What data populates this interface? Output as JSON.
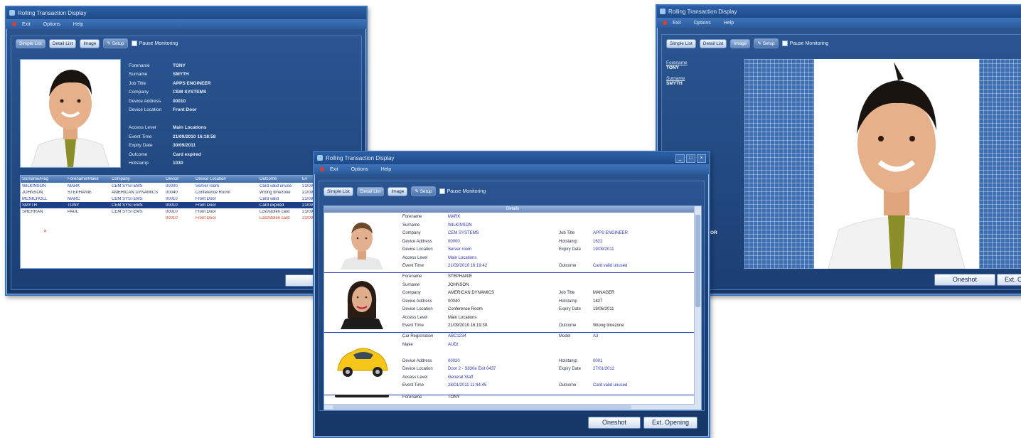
{
  "windows": {
    "title": "Rolling Transaction Display",
    "menu": [
      "Exit",
      "Options",
      "Help"
    ],
    "buttons": {
      "simple_list": "Simple List",
      "detail_list": "Detail List",
      "image": "Image",
      "setup": "Setup",
      "pause": "Pause Monitoring",
      "oneshot": "Oneshot",
      "ext_opening": "Ext. Opening",
      "oneshot_cut": "Onesh",
      "ext_cut": "Ext. Op"
    }
  },
  "left": {
    "fields": [
      {
        "k": "Forename",
        "v": "TONY"
      },
      {
        "k": "Surname",
        "v": "SMYTH"
      },
      {
        "k": "Job Title",
        "v": "APPS ENGINEER"
      },
      {
        "k": "Company",
        "v": "CEM SYSTEMS"
      },
      {
        "k": "Device Address",
        "v": "00010"
      },
      {
        "k": "Device Location",
        "v": "Front Door"
      },
      {
        "k": "",
        "v": ""
      },
      {
        "k": "Access Level",
        "v": "Main Locations"
      },
      {
        "k": "Event Time",
        "v": "21/09/2010 16:18:58"
      },
      {
        "k": "Expiry Date",
        "v": "30/09/2011"
      },
      {
        "k": "Outcome",
        "v": "Card expired"
      },
      {
        "k": "Hotstamp",
        "v": "1030"
      }
    ],
    "table": {
      "headers": [
        "Surname/Reg",
        "Forename/Make",
        "Company",
        "Device",
        "Device Location",
        "Outcome",
        "Ev"
      ],
      "rows": [
        [
          "WILKINSON",
          "MARK",
          "CEM SYSTEMS",
          "00000",
          "Server room",
          "Card valid unuse",
          "21/09/"
        ],
        [
          "JOHNSON",
          "STEPHANIE",
          "AMERICAN DYNAMICS",
          "00040",
          "Conference Room",
          "Wrong timezone",
          "21/09/"
        ],
        [
          "MCNICHOLL",
          "MARC",
          "CEM SYSTEMS",
          "00010",
          "Front Door",
          "Card valid",
          "21/09/"
        ],
        [
          "SMYTH",
          "TONY",
          "CEM SYSTEMS",
          "00010",
          "Front Door",
          "Card expired",
          "21/09/"
        ],
        [
          "SHERRAN",
          "PAUL",
          "CEM SYSTEMS",
          "00010",
          "Front Door",
          "Lost/stolen card",
          "21/09/"
        ],
        [
          "",
          "",
          "",
          "00010",
          "Front Door",
          "Lost/stolen card",
          "21/09/"
        ]
      ]
    }
  },
  "right": {
    "forename_label": "Forename",
    "forename": "TONY",
    "surname_label": "Surname",
    "surname": "SMYTH",
    "stray": "OR"
  },
  "middle": {
    "details_header": "Details",
    "cards": [
      {
        "left": [
          [
            "Forename",
            "MARK"
          ],
          [
            "Surname",
            "WILKINSON"
          ],
          [
            "Company",
            "CEM SYSTEMS"
          ],
          [
            "Device Address",
            "00000"
          ],
          [
            "Device Location",
            "Server room"
          ],
          [
            "Access Level",
            "Main Locations"
          ],
          [
            "Event Time",
            "21/09/2010 16:19:42"
          ]
        ],
        "right": [
          [
            "Job Title",
            "APPS ENGINEER"
          ],
          [
            "Hotstamp",
            "1622"
          ],
          [
            "Expiry Date",
            "19/09/2011"
          ],
          [
            "",
            ""
          ],
          [
            "Outcome",
            "Card valid unused"
          ]
        ]
      },
      {
        "left": [
          [
            "Forename",
            "STEPHANIE"
          ],
          [
            "Surname",
            "JOHNSON"
          ],
          [
            "Company",
            "AMERICAN DYNAMICS"
          ],
          [
            "Device Address",
            "00040"
          ],
          [
            "Device Location",
            "Conference Room"
          ],
          [
            "Access Level",
            "Main Locations"
          ],
          [
            "Event Time",
            "21/09/2010 16:19:30"
          ]
        ],
        "right": [
          [
            "Job Title",
            "MANAGER"
          ],
          [
            "Hotstamp",
            "1827"
          ],
          [
            "Expiry Date",
            "19/06/2011"
          ],
          [
            "",
            ""
          ],
          [
            "Outcome",
            "Wrong timezone"
          ]
        ]
      },
      {
        "left": [
          [
            "Car Registration",
            "ABC1234"
          ],
          [
            "Make",
            "AUDI"
          ],
          [
            "",
            ""
          ],
          [
            "Device Address",
            "00020"
          ],
          [
            "Device Location",
            "Door 2 - S830e Exit 0437"
          ],
          [
            "Access Level",
            "General Staff"
          ],
          [
            "Event Time",
            "28/01/2011 11:44:45"
          ]
        ],
        "right": [
          [
            "Model",
            "A3"
          ],
          [
            "",
            ""
          ],
          [
            "Hotstamp",
            "0001"
          ],
          [
            "Expiry Date",
            "27/01/2012"
          ],
          [
            "Outcome",
            "Card valid unused"
          ]
        ]
      }
    ],
    "partial": [
      [
        "Forename",
        "TONY"
      ]
    ]
  }
}
